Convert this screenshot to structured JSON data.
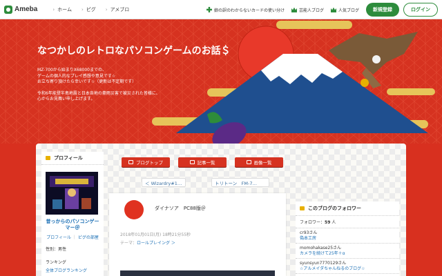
{
  "topbar": {
    "logo": "Ameba",
    "nav": [
      "ホーム",
      "ピグ",
      "アメブロ"
    ],
    "right_links": [
      {
        "label": "芸能人ブログ",
        "icon": "crown-icon"
      },
      {
        "label": "人気ブログ",
        "icon": "crown-icon"
      }
    ],
    "promo_label": "娘の訳のわからないカードの使い分け",
    "register_label": "新規登録",
    "login_label": "ログイン",
    "accent": "#2d8c3c"
  },
  "header": {
    "title": "なつかしのレトロなパソコンゲームのお話＄",
    "desc_lines": [
      "MZ-700から始まりX68000までの、",
      "ゲームの個人的なプレイ感想や意見です☆",
      "お立ち寄り頂けたら幸いです☆（更新は不定期です）"
    ],
    "desc_lines2": [
      "令和6年能登半島地震と日本各地の豪雨災害で被災された皆様に、",
      "心からお見舞い申し上げます。"
    ],
    "bg_color": "#d63220"
  },
  "tabs": [
    {
      "label": "ブログトップ",
      "icon": "home-icon"
    },
    {
      "label": "記事一覧",
      "icon": "list-icon"
    },
    {
      "label": "画像一覧",
      "icon": "camera-icon"
    }
  ],
  "pager": {
    "prev": "＜ Wizardry#1…",
    "next": "トリトーン　FM-7…"
  },
  "sidebar_left": {
    "title": "プロフィール",
    "name": "昔っからのパソコンゲーマー＠",
    "links": [
      "プロフィール",
      "ピグの部屋"
    ],
    "gender": "性別：男性",
    "ranking_label": "ランキング",
    "ranking_link": "全体ブログランキング"
  },
  "article": {
    "author": "ダイナソア　PC88版＠",
    "date": "2018年01月01日(月) 18時21分55秒",
    "theme_label": "テーマ：",
    "theme": "ロールプレイング ＞"
  },
  "sidebar_right": {
    "title": "このブログのフォロワー",
    "count_label": "フォロワー：",
    "count": "59",
    "count_unit": "人",
    "followers": [
      {
        "name": "cr93さん",
        "blog": "偽本工房"
      },
      {
        "name": "momohakase25さん",
        "blog": "カメラを続けて25年＋α"
      },
      {
        "name": "syunsyun7770129さん",
        "blog": "☆アルメイダちゃんねるのブログ☆"
      }
    ]
  }
}
